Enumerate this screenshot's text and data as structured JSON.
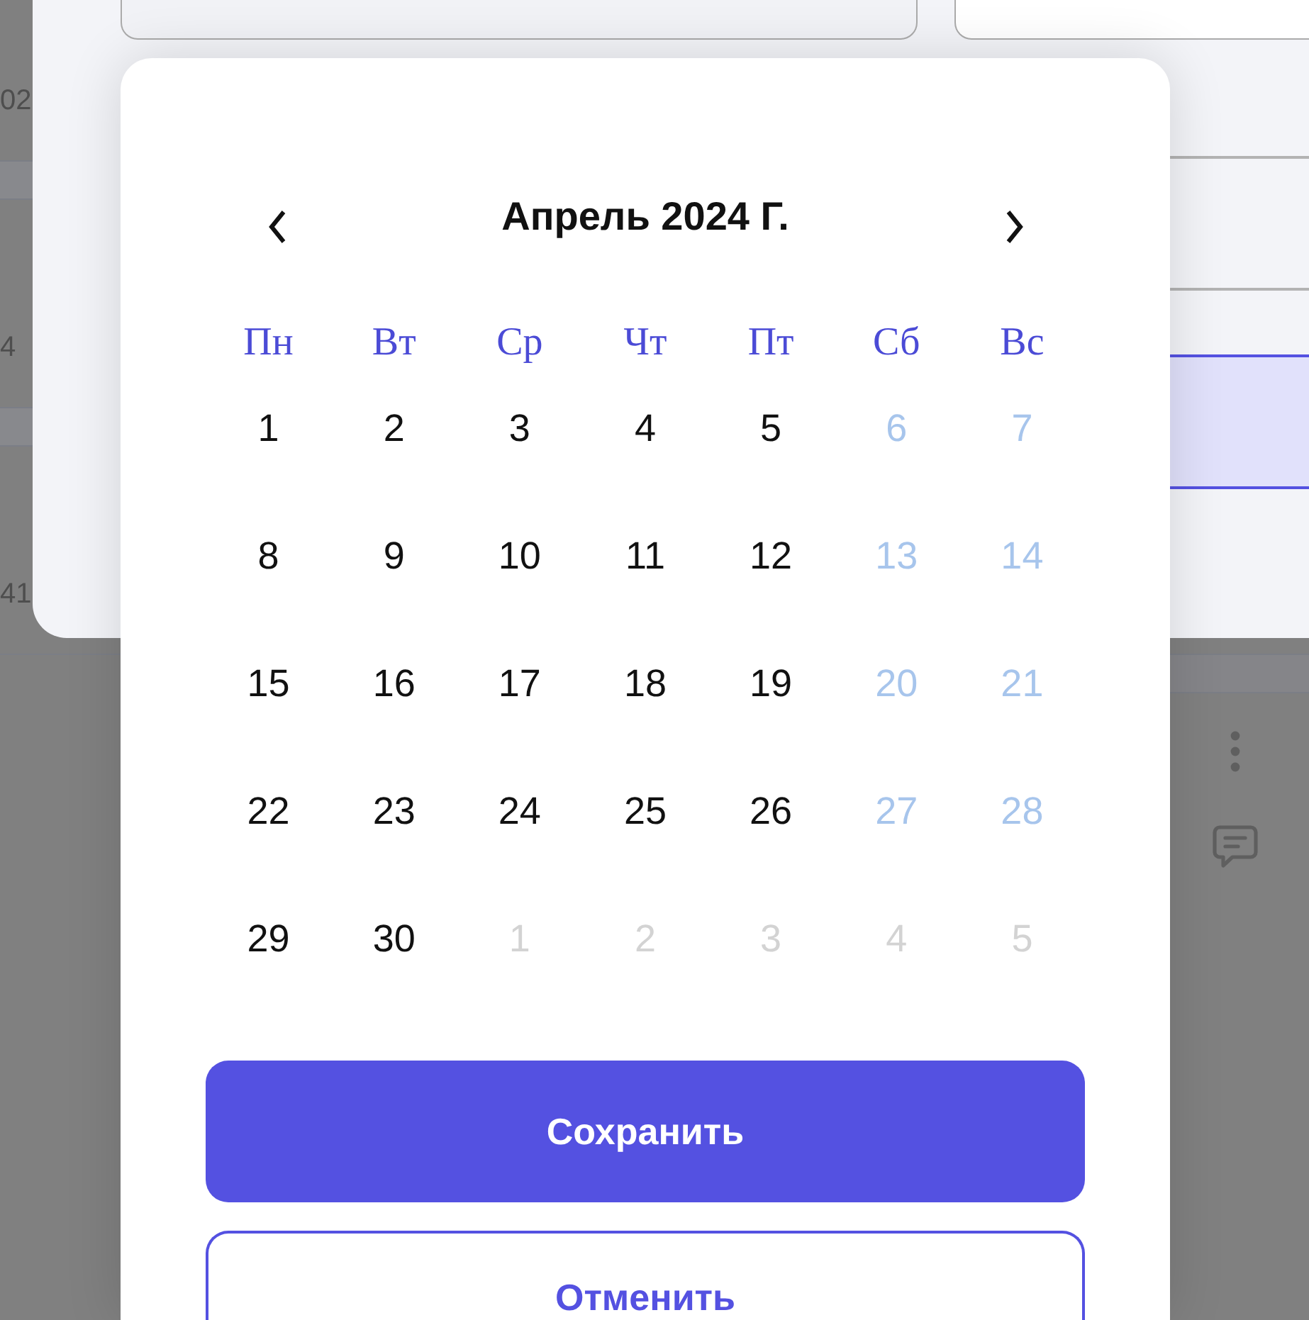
{
  "background_table": {
    "rows": [
      {
        "kind": "value",
        "cell": "02"
      },
      {
        "kind": "value",
        "cell": "4"
      },
      {
        "kind": "value",
        "cell": "41"
      },
      {
        "kind": "actions"
      }
    ]
  },
  "dialog": {
    "fields": [
      {
        "disabled": true
      },
      {
        "disabled": false
      }
    ],
    "options": [
      {
        "selected": false
      },
      {
        "selected": true
      }
    ]
  },
  "date_picker": {
    "title": "Апрель 2024 Г.",
    "weekdays": [
      "Пн",
      "Вт",
      "Ср",
      "Чт",
      "Пт",
      "Сб",
      "Вс"
    ],
    "weeks": [
      [
        {
          "day": "1",
          "kind": "weekday"
        },
        {
          "day": "2",
          "kind": "weekday"
        },
        {
          "day": "3",
          "kind": "weekday"
        },
        {
          "day": "4",
          "kind": "weekday"
        },
        {
          "day": "5",
          "kind": "weekday"
        },
        {
          "day": "6",
          "kind": "weekend"
        },
        {
          "day": "7",
          "kind": "weekend"
        }
      ],
      [
        {
          "day": "8",
          "kind": "weekday"
        },
        {
          "day": "9",
          "kind": "weekday"
        },
        {
          "day": "10",
          "kind": "weekday"
        },
        {
          "day": "11",
          "kind": "weekday"
        },
        {
          "day": "12",
          "kind": "weekday"
        },
        {
          "day": "13",
          "kind": "weekend"
        },
        {
          "day": "14",
          "kind": "weekend"
        }
      ],
      [
        {
          "day": "15",
          "kind": "weekday"
        },
        {
          "day": "16",
          "kind": "weekday"
        },
        {
          "day": "17",
          "kind": "weekday"
        },
        {
          "day": "18",
          "kind": "weekday"
        },
        {
          "day": "19",
          "kind": "weekday"
        },
        {
          "day": "20",
          "kind": "weekend"
        },
        {
          "day": "21",
          "kind": "weekend"
        }
      ],
      [
        {
          "day": "22",
          "kind": "weekday"
        },
        {
          "day": "23",
          "kind": "weekday"
        },
        {
          "day": "24",
          "kind": "weekday"
        },
        {
          "day": "25",
          "kind": "weekday"
        },
        {
          "day": "26",
          "kind": "weekday"
        },
        {
          "day": "27",
          "kind": "weekend"
        },
        {
          "day": "28",
          "kind": "weekend"
        }
      ],
      [
        {
          "day": "29",
          "kind": "weekday"
        },
        {
          "day": "30",
          "kind": "weekday"
        },
        {
          "day": "1",
          "kind": "other_month"
        },
        {
          "day": "2",
          "kind": "other_month"
        },
        {
          "day": "3",
          "kind": "other_month"
        },
        {
          "day": "4",
          "kind": "other_month"
        },
        {
          "day": "5",
          "kind": "other_month"
        }
      ]
    ],
    "buttons": [
      {
        "label": "Сохранить",
        "kind": "primary"
      },
      {
        "label": "Отменить",
        "kind": "secondary"
      }
    ]
  }
}
